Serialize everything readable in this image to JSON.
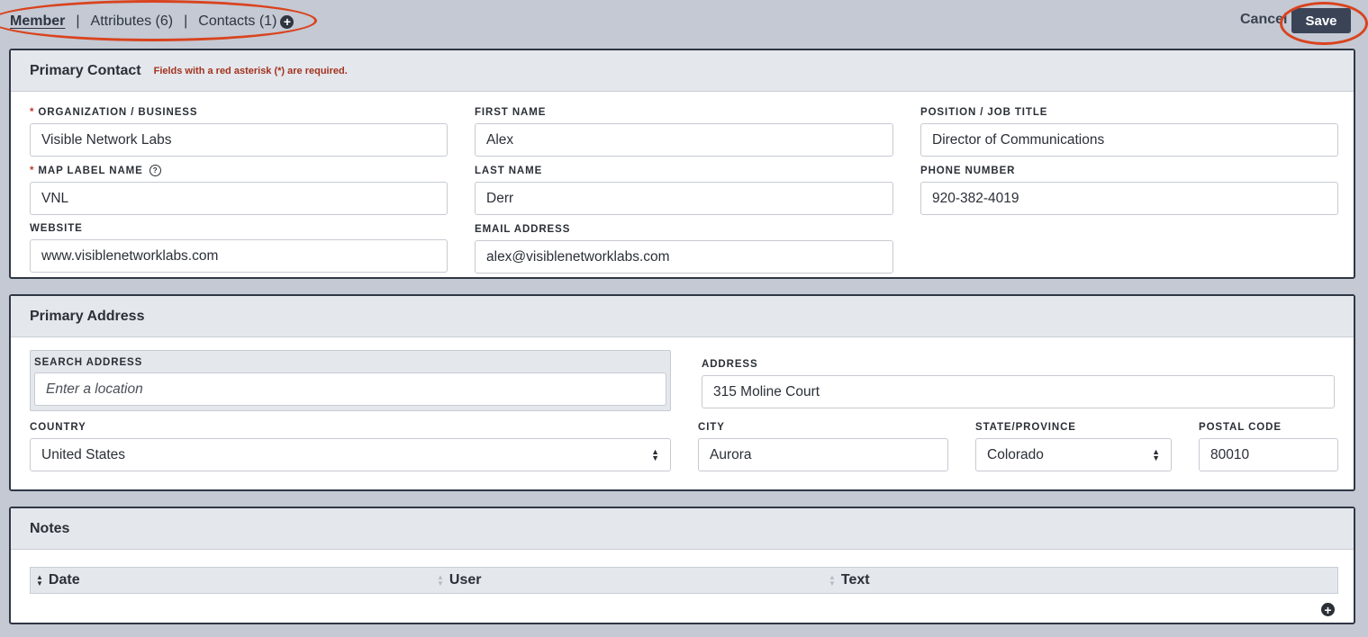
{
  "tabs": {
    "member": "Member",
    "sep1": "|",
    "attributes": "Attributes (6)",
    "sep2": "|",
    "contacts": "Contacts (1)",
    "contacts_add": "+"
  },
  "actions": {
    "cancel": "Cancel",
    "save": "Save"
  },
  "annotation_color": "#d9431e",
  "primary_contact": {
    "title": "Primary Contact",
    "required_note": "Fields with a red asterisk (*) are required.",
    "org_label": "Organization / Business",
    "org_value": "Visible Network Labs",
    "map_label": "Map Label Name",
    "map_value": "VNL",
    "map_help": "?",
    "website_label": "Website",
    "website_value": "www.visiblenetworklabs.com",
    "first_label": "First Name",
    "first_value": "Alex",
    "last_label": "Last Name",
    "last_value": "Derr",
    "email_label": "Email Address",
    "email_value": "alex@visiblenetworklabs.com",
    "position_label": "Position / Job Title",
    "position_value": "Director of Communications",
    "phone_label": "Phone Number",
    "phone_value": "920-382-4019",
    "asterisk": "*"
  },
  "primary_address": {
    "title": "Primary Address",
    "search_label": "Search Address",
    "search_placeholder": "Enter a location",
    "address_label": "Address",
    "address_value": "315 Moline Court",
    "country_label": "Country",
    "country_value": "United States",
    "city_label": "City",
    "city_value": "Aurora",
    "state_label": "State/Province",
    "state_value": "Colorado",
    "postal_label": "Postal Code",
    "postal_value": "80010"
  },
  "notes": {
    "title": "Notes",
    "columns": [
      "Date",
      "User",
      "Text"
    ],
    "add": "+"
  }
}
